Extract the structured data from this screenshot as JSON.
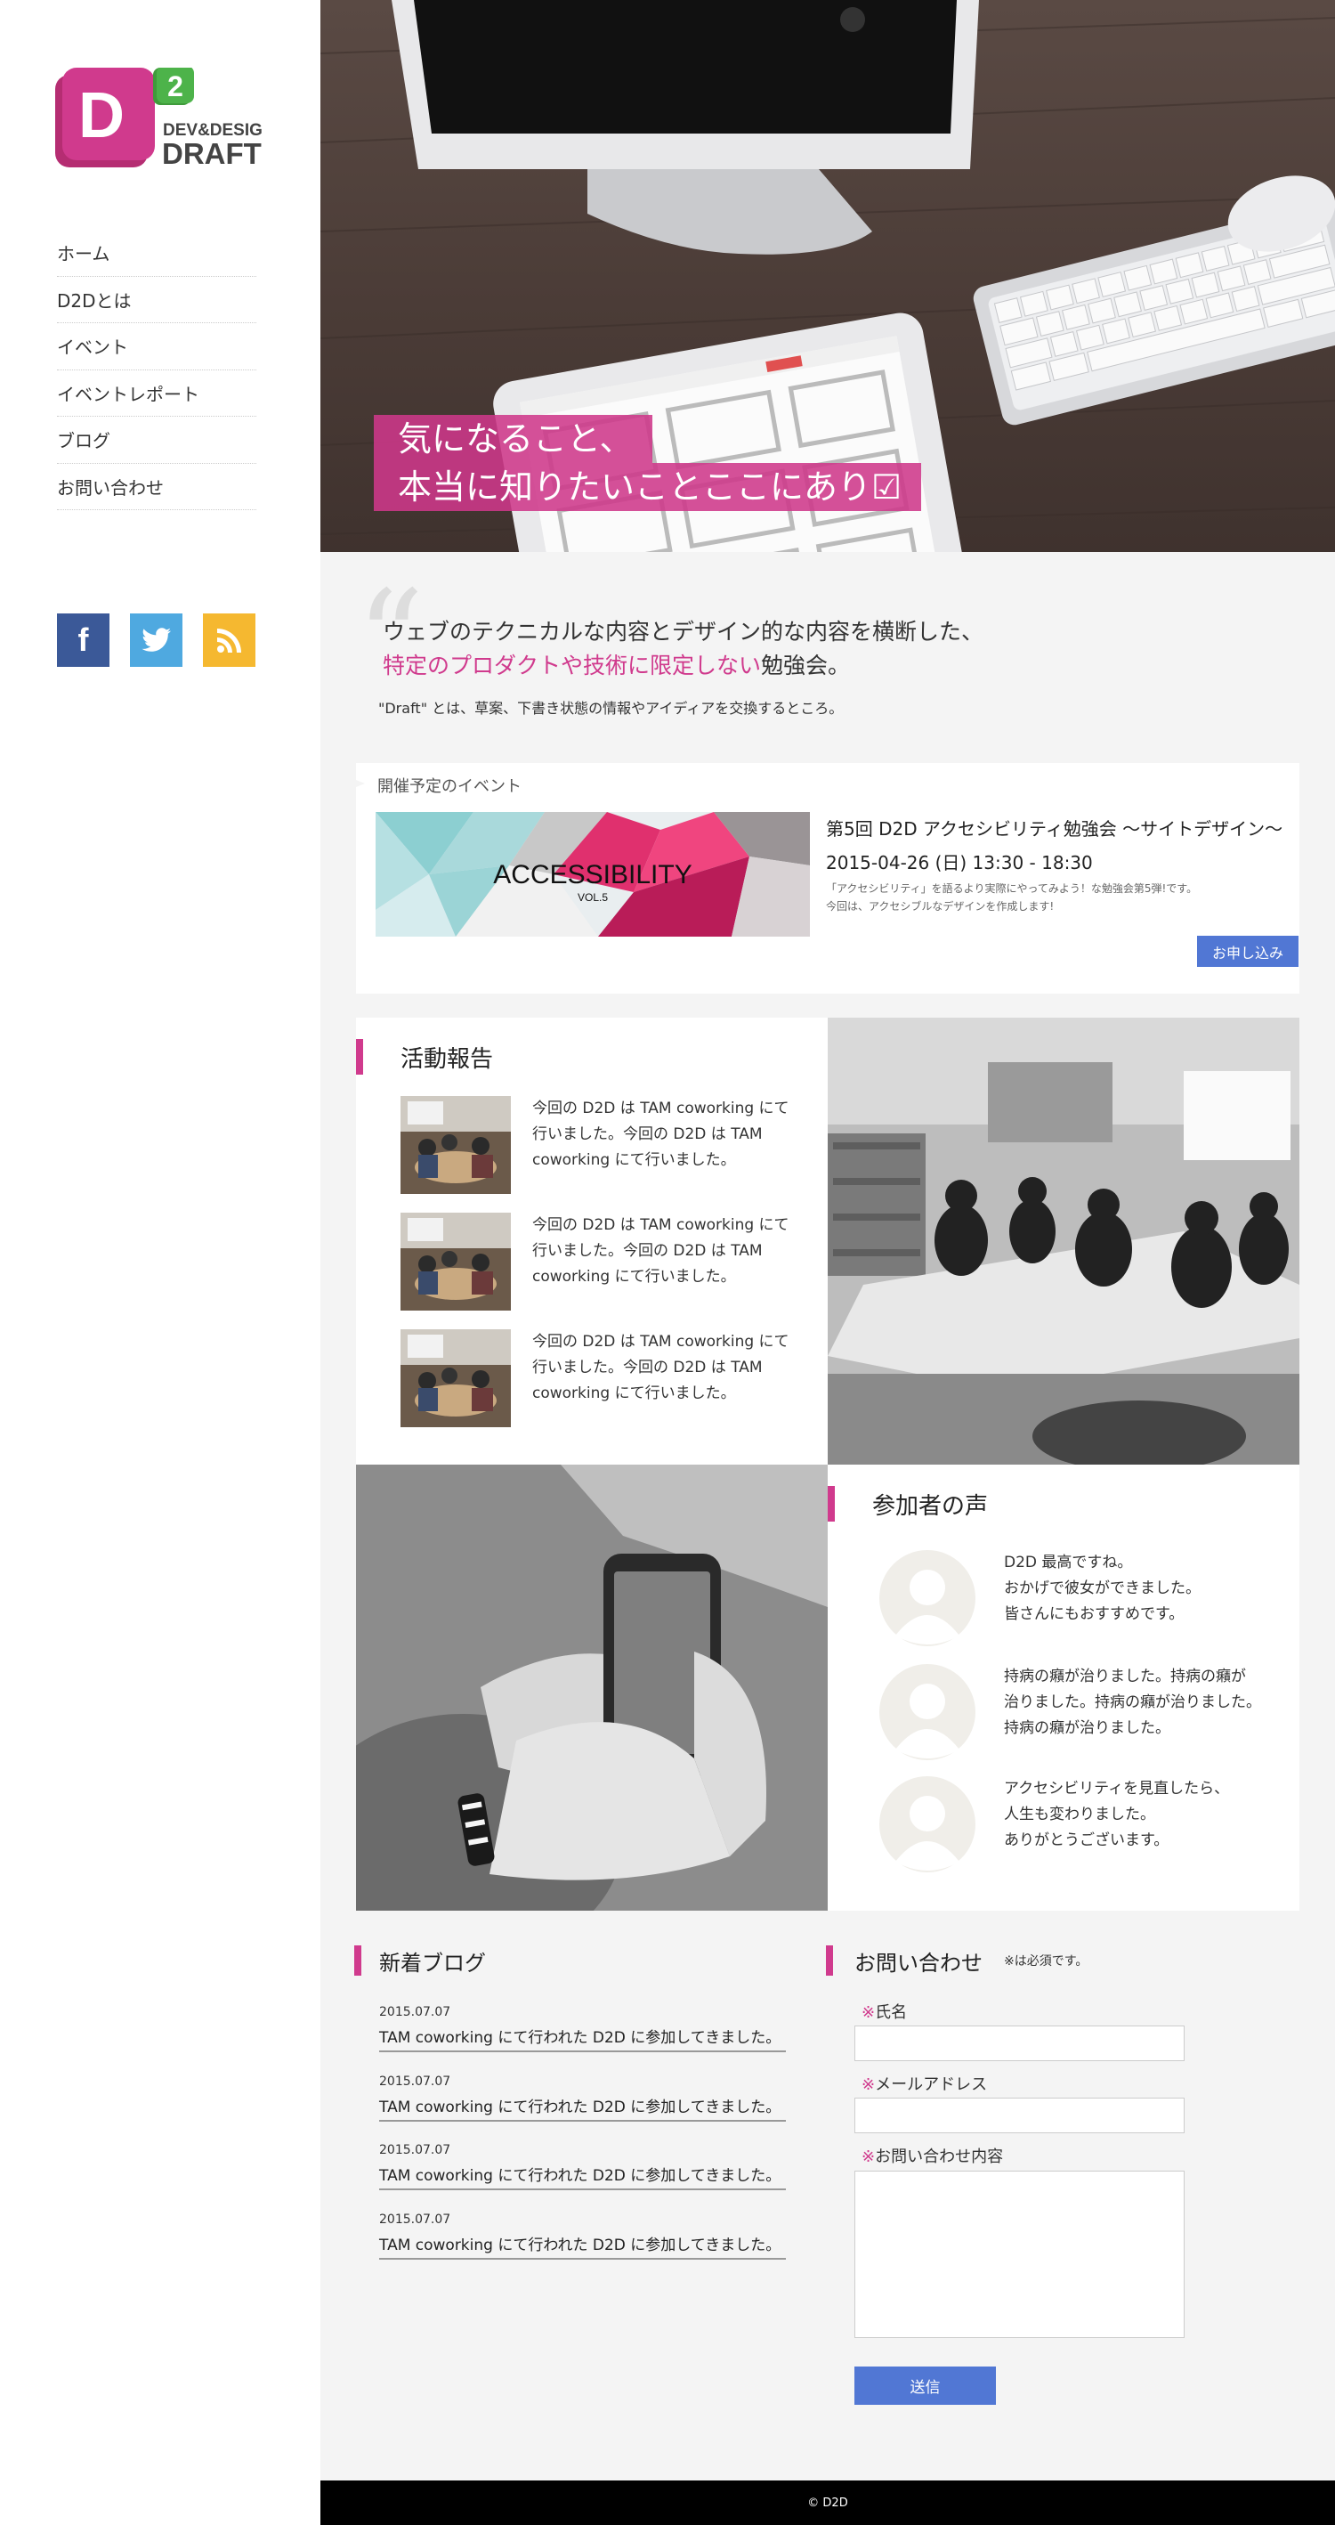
{
  "brand": {
    "logo_letter": "D",
    "logo_sup": "2",
    "logo_line1": "DEV&DESIGN",
    "logo_line2": "DRAFT",
    "accent": "#d03a8d",
    "green": "#4db34a",
    "blue": "#5177d4"
  },
  "nav": {
    "items": [
      {
        "label": "ホーム"
      },
      {
        "label": "D2Dとは"
      },
      {
        "label": "イベント"
      },
      {
        "label": "イベントレポート"
      },
      {
        "label": "ブログ"
      },
      {
        "label": "お問い合わせ"
      }
    ]
  },
  "social": {
    "icons": [
      "facebook-icon",
      "twitter-icon",
      "rss-icon"
    ],
    "facebook_letter": "f"
  },
  "hero": {
    "line1": "気になること、",
    "line2": "本当に知りたいことここにあり",
    "line2_mark": "☑"
  },
  "intro": {
    "line1": "ウェブのテクニカルな内容とデザイン的な内容を横断した、",
    "line2_highlight": "特定のプロダクトや技術に限定しない",
    "line2_rest": "勉強会。",
    "line3": "\"Draft\" とは、草案、下書き状態の情報やアイディアを交換するところ。"
  },
  "event": {
    "heading": "開催予定のイベント",
    "banner_title": "ACCESSIBILITY",
    "banner_sub": "VOL.5",
    "title": "第5回 D2D アクセシビリティ勉強会 〜サイトデザイン〜",
    "date": "2015-04-26 (日) 13:30 - 18:30",
    "desc1": "「アクセシビリティ」を語るより実際にやってみよう！な勉強会第5弾!です。",
    "desc2": "今回は、アクセシブルなデザインを作成します!",
    "apply_label": "お申し込み"
  },
  "activity": {
    "title": "活動報告",
    "items": [
      {
        "text": "今回の D2D は TAM coworking にて行いました。今回の D2D は TAM coworking にて行いました。"
      },
      {
        "text": "今回の D2D は TAM coworking にて行いました。今回の D2D は TAM coworking にて行いました。"
      },
      {
        "text": "今回の D2D は TAM coworking にて行いました。今回の D2D は TAM coworking にて行いました。"
      }
    ]
  },
  "voices": {
    "title": "参加者の声",
    "items": [
      {
        "l1": "D2D 最高ですね。",
        "l2": "おかげで彼女ができました。",
        "l3": "皆さんにもおすすめです。"
      },
      {
        "l1": "持病の癪が治りました。持病の癪が",
        "l2": "治りました。持病の癪が治りました。",
        "l3": "持病の癪が治りました。"
      },
      {
        "l1": "アクセシビリティを見直したら、",
        "l2": "人生も変わりました。",
        "l3": "ありがとうございます。"
      }
    ]
  },
  "blog": {
    "title": "新着ブログ",
    "items": [
      {
        "date": "2015.07.07",
        "title": "TAM coworking にて行われた D2D に参加してきました。"
      },
      {
        "date": "2015.07.07",
        "title": "TAM coworking にて行われた D2D に参加してきました。"
      },
      {
        "date": "2015.07.07",
        "title": "TAM coworking にて行われた D2D に参加してきました。"
      },
      {
        "date": "2015.07.07",
        "title": "TAM coworking にて行われた D2D に参加してきました。"
      }
    ]
  },
  "contact": {
    "title": "お問い合わせ",
    "note": "※は必須です。",
    "required_mark": "※",
    "name_label": "氏名",
    "email_label": "メールアドレス",
    "message_label": "お問い合わせ内容",
    "name_value": "",
    "email_value": "",
    "message_value": "",
    "send_label": "送信"
  },
  "footer": {
    "copyright": "© D2D"
  }
}
